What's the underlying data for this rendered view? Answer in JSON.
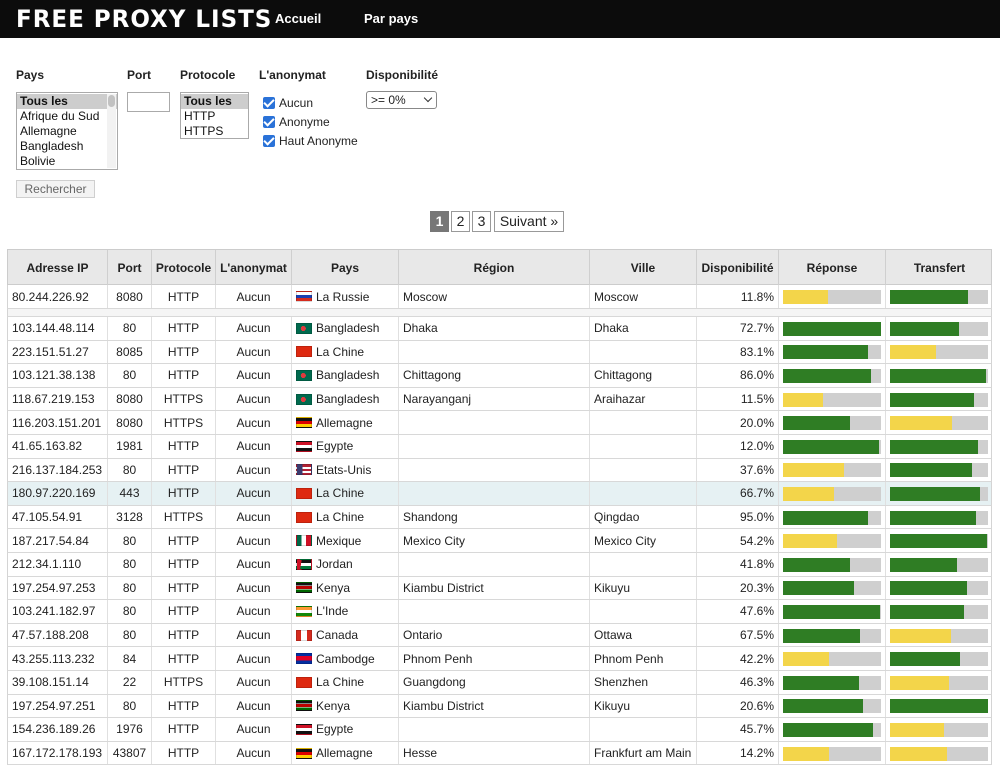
{
  "header": {
    "logo": "FREE PROXY LISTS",
    "nav": [
      "Accueil",
      "Par pays"
    ]
  },
  "filters": {
    "country_label": "Pays",
    "port_label": "Port",
    "protocol_label": "Protocole",
    "anonymity_label": "L'anonymat",
    "availability_label": "Disponibilité",
    "countries": [
      "Tous les",
      "Afrique du Sud",
      "Allemagne",
      "Bangladesh",
      "Bolivie"
    ],
    "protocols": [
      "Tous les",
      "HTTP",
      "HTTPS"
    ],
    "anonymity_options": [
      "Aucun",
      "Anonyme",
      "Haut Anonyme"
    ],
    "availability_value": ">= 0%",
    "search_button": "Rechercher"
  },
  "pagination": {
    "pages": [
      "1",
      "2",
      "3"
    ],
    "current": "1",
    "next": "Suivant »"
  },
  "table": {
    "headers": [
      "Adresse IP",
      "Port",
      "Protocole",
      "L'anonymat",
      "Pays",
      "Région",
      "Ville",
      "Disponibilité",
      "Réponse",
      "Transfert"
    ],
    "rows": [
      {
        "ip": "80.244.226.92",
        "port": "8080",
        "protocol": "HTTP",
        "anonymity": "Aucun",
        "country": "La Russie",
        "flag": "ru",
        "region": "Moscow",
        "city": "Moscow",
        "availability": "11.8%",
        "response": 0.46,
        "response_color": "#f3d54a",
        "transfer": 0.8,
        "transfer_color": "#2f7d24"
      },
      {
        "ip": "103.144.48.114",
        "port": "80",
        "protocol": "HTTP",
        "anonymity": "Aucun",
        "country": "Bangladesh",
        "flag": "bd",
        "region": "Dhaka",
        "city": "Dhaka",
        "availability": "72.7%",
        "response": 1.0,
        "response_color": "#2f7d24",
        "transfer": 0.7,
        "transfer_color": "#2f7d24"
      },
      {
        "ip": "223.151.51.27",
        "port": "8085",
        "protocol": "HTTP",
        "anonymity": "Aucun",
        "country": "La Chine",
        "flag": "cn",
        "region": "",
        "city": "",
        "availability": "83.1%",
        "response": 0.87,
        "response_color": "#2f7d24",
        "transfer": 0.47,
        "transfer_color": "#f3d54a"
      },
      {
        "ip": "103.121.38.138",
        "port": "80",
        "protocol": "HTTP",
        "anonymity": "Aucun",
        "country": "Bangladesh",
        "flag": "bd",
        "region": "Chittagong",
        "city": "Chittagong",
        "availability": "86.0%",
        "response": 0.9,
        "response_color": "#2f7d24",
        "transfer": 0.98,
        "transfer_color": "#2f7d24"
      },
      {
        "ip": "118.67.219.153",
        "port": "8080",
        "protocol": "HTTPS",
        "anonymity": "Aucun",
        "country": "Bangladesh",
        "flag": "bd",
        "region": "Narayanganj",
        "city": "Araihazar",
        "availability": "11.5%",
        "response": 0.41,
        "response_color": "#f3d54a",
        "transfer": 0.86,
        "transfer_color": "#2f7d24"
      },
      {
        "ip": "116.203.151.201",
        "port": "8080",
        "protocol": "HTTPS",
        "anonymity": "Aucun",
        "country": "Allemagne",
        "flag": "de",
        "region": "",
        "city": "",
        "availability": "20.0%",
        "response": 0.68,
        "response_color": "#2f7d24",
        "transfer": 0.63,
        "transfer_color": "#f3d54a"
      },
      {
        "ip": "41.65.163.82",
        "port": "1981",
        "protocol": "HTTP",
        "anonymity": "Aucun",
        "country": "Egypte",
        "flag": "eg",
        "region": "",
        "city": "",
        "availability": "12.0%",
        "response": 0.98,
        "response_color": "#2f7d24",
        "transfer": 0.9,
        "transfer_color": "#2f7d24"
      },
      {
        "ip": "216.137.184.253",
        "port": "80",
        "protocol": "HTTP",
        "anonymity": "Aucun",
        "country": "Etats-Unis",
        "flag": "us",
        "region": "",
        "city": "",
        "availability": "37.6%",
        "response": 0.62,
        "response_color": "#f3d54a",
        "transfer": 0.84,
        "transfer_color": "#2f7d24"
      },
      {
        "ip": "180.97.220.169",
        "port": "443",
        "protocol": "HTTP",
        "anonymity": "Aucun",
        "country": "La Chine",
        "flag": "cn",
        "region": "",
        "city": "",
        "availability": "66.7%",
        "response": 0.52,
        "response_color": "#f3d54a",
        "transfer": 0.92,
        "transfer_color": "#2f7d24",
        "highlight": true
      },
      {
        "ip": "47.105.54.91",
        "port": "3128",
        "protocol": "HTTPS",
        "anonymity": "Aucun",
        "country": "La Chine",
        "flag": "cn",
        "region": "Shandong",
        "city": "Qingdao",
        "availability": "95.0%",
        "response": 0.87,
        "response_color": "#2f7d24",
        "transfer": 0.88,
        "transfer_color": "#2f7d24"
      },
      {
        "ip": "187.217.54.84",
        "port": "80",
        "protocol": "HTTP",
        "anonymity": "Aucun",
        "country": "Mexique",
        "flag": "mx",
        "region": "Mexico City",
        "city": "Mexico City",
        "availability": "54.2%",
        "response": 0.55,
        "response_color": "#f3d54a",
        "transfer": 0.99,
        "transfer_color": "#2f7d24"
      },
      {
        "ip": "212.34.1.110",
        "port": "80",
        "protocol": "HTTP",
        "anonymity": "Aucun",
        "country": "Jordan",
        "flag": "jo",
        "region": "",
        "city": "",
        "availability": "41.8%",
        "response": 0.68,
        "response_color": "#2f7d24",
        "transfer": 0.68,
        "transfer_color": "#2f7d24"
      },
      {
        "ip": "197.254.97.253",
        "port": "80",
        "protocol": "HTTP",
        "anonymity": "Aucun",
        "country": "Kenya",
        "flag": "ke",
        "region": "Kiambu District",
        "city": "Kikuyu",
        "availability": "20.3%",
        "response": 0.72,
        "response_color": "#2f7d24",
        "transfer": 0.79,
        "transfer_color": "#2f7d24"
      },
      {
        "ip": "103.241.182.97",
        "port": "80",
        "protocol": "HTTP",
        "anonymity": "Aucun",
        "country": "L'Inde",
        "flag": "in",
        "region": "",
        "city": "",
        "availability": "47.6%",
        "response": 0.99,
        "response_color": "#2f7d24",
        "transfer": 0.75,
        "transfer_color": "#2f7d24"
      },
      {
        "ip": "47.57.188.208",
        "port": "80",
        "protocol": "HTTP",
        "anonymity": "Aucun",
        "country": "Canada",
        "flag": "ca",
        "region": "Ontario",
        "city": "Ottawa",
        "availability": "67.5%",
        "response": 0.79,
        "response_color": "#2f7d24",
        "transfer": 0.62,
        "transfer_color": "#f3d54a"
      },
      {
        "ip": "43.255.113.232",
        "port": "84",
        "protocol": "HTTP",
        "anonymity": "Aucun",
        "country": "Cambodge",
        "flag": "kh",
        "region": "Phnom Penh",
        "city": "Phnom Penh",
        "availability": "42.2%",
        "response": 0.47,
        "response_color": "#f3d54a",
        "transfer": 0.71,
        "transfer_color": "#2f7d24"
      },
      {
        "ip": "39.108.151.14",
        "port": "22",
        "protocol": "HTTPS",
        "anonymity": "Aucun",
        "country": "La Chine",
        "flag": "cn",
        "region": "Guangdong",
        "city": "Shenzhen",
        "availability": "46.3%",
        "response": 0.78,
        "response_color": "#2f7d24",
        "transfer": 0.6,
        "transfer_color": "#f3d54a"
      },
      {
        "ip": "197.254.97.251",
        "port": "80",
        "protocol": "HTTP",
        "anonymity": "Aucun",
        "country": "Kenya",
        "flag": "ke",
        "region": "Kiambu District",
        "city": "Kikuyu",
        "availability": "20.6%",
        "response": 0.82,
        "response_color": "#2f7d24",
        "transfer": 1.0,
        "transfer_color": "#2f7d24"
      },
      {
        "ip": "154.236.189.26",
        "port": "1976",
        "protocol": "HTTP",
        "anonymity": "Aucun",
        "country": "Egypte",
        "flag": "eg",
        "region": "",
        "city": "",
        "availability": "45.7%",
        "response": 0.92,
        "response_color": "#2f7d24",
        "transfer": 0.55,
        "transfer_color": "#f3d54a"
      },
      {
        "ip": "167.172.178.193",
        "port": "43807",
        "protocol": "HTTP",
        "anonymity": "Aucun",
        "country": "Allemagne",
        "flag": "de",
        "region": "Hesse",
        "city": "Frankfurt am Main",
        "availability": "14.2%",
        "response": 0.47,
        "response_color": "#f3d54a",
        "transfer": 0.58,
        "transfer_color": "#f3d54a"
      }
    ]
  }
}
